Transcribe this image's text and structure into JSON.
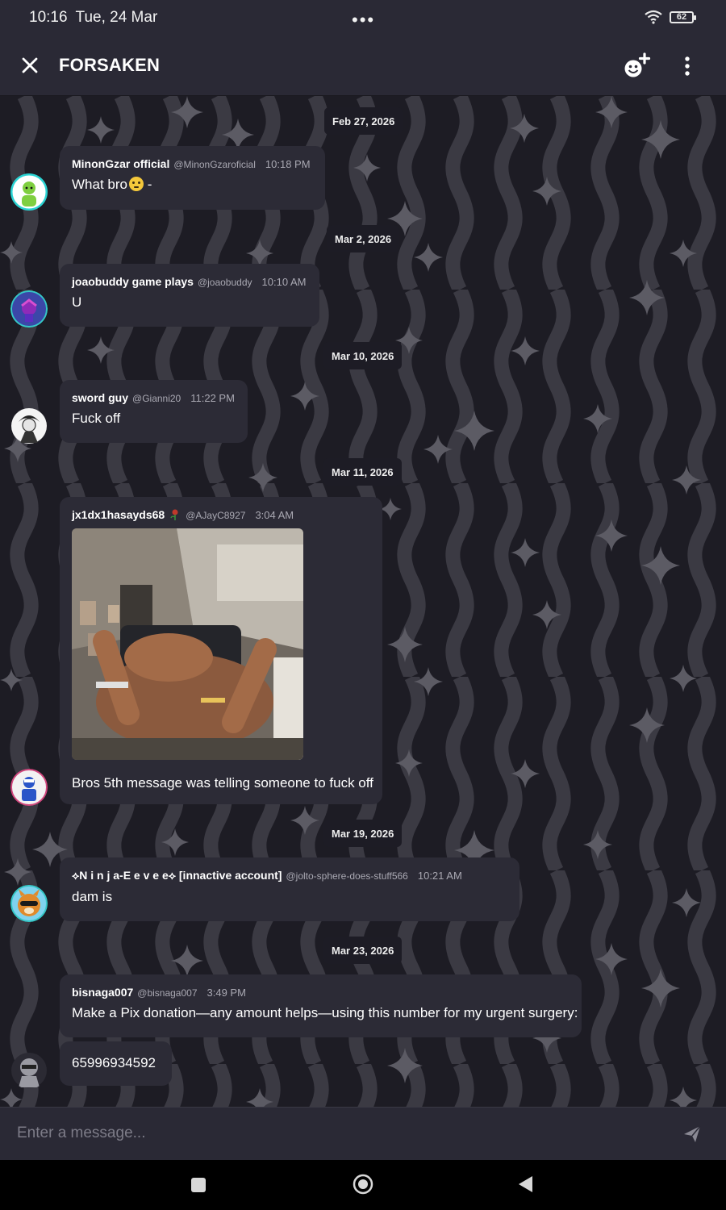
{
  "status_bar": {
    "time": "10:16",
    "date": "Tue, 24 Mar",
    "battery": "62",
    "icons": [
      "more-dots-icon",
      "wifi-icon",
      "battery-icon"
    ]
  },
  "header": {
    "title": "FORSAKEN",
    "icons": [
      "close-icon",
      "add-member-icon",
      "more-vert-icon"
    ]
  },
  "messages": [
    {
      "date": "Feb 27, 2026",
      "author": "MinonGzar official",
      "handle": "@MinonGzaroficial",
      "time": "10:18 PM",
      "text": "What bro",
      "text_suffix": "-"
    },
    {
      "date": "Mar 2, 2026",
      "author": "joaobuddy game plays",
      "handle": "@joaobuddy",
      "time": "10:10 AM",
      "text": "U"
    },
    {
      "date": "Mar 10, 2026",
      "author": "sword guy",
      "handle": "@Gianni20",
      "time": "11:22 PM",
      "text": "Fuck off"
    },
    {
      "date": "Mar 11, 2026",
      "author": "jx1dx1hasayds68",
      "handle": "@AJayC8927",
      "time": "3:04 AM",
      "text": "Bros 5th message was telling someone to fuck off",
      "has_image": true
    },
    {
      "date": "Mar 19, 2026",
      "author": "⟡N i n j a-E e v e e⟡ [innactive account]",
      "handle": "@jolto-sphere-does-stuff566",
      "time": "10:21 AM",
      "text": "dam is"
    },
    {
      "date": "Mar 23, 2026",
      "author": "bisnaga007",
      "handle": "@bisnaga007",
      "time": "3:49 PM",
      "text": "Make a Pix donation—any amount helps—using this number for my urgent surgery:",
      "followup": "65996934592"
    }
  ],
  "composer": {
    "placeholder": "Enter a message..."
  },
  "colors": {
    "bar_bg": "#2a2935",
    "bubble_bg": "#2c2b36",
    "pattern_dark": "#1d1c24",
    "pattern_light": "#3b3a43",
    "sparkle": "#5a5962"
  }
}
